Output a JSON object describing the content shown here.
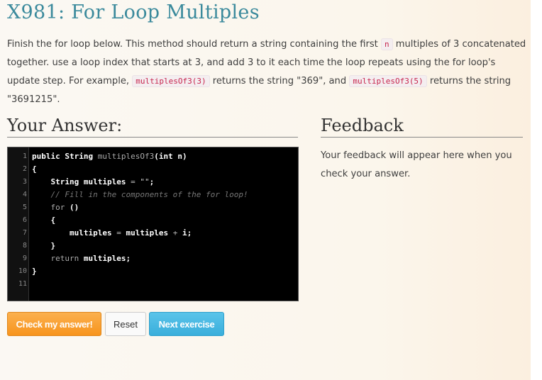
{
  "title": "X981: For Loop Multiples",
  "description": {
    "p1": "Finish the for loop below. This method should return a string containing the first ",
    "code_n": "n",
    "p2": " multiples of 3 concatenated together. use a loop index that starts at 3, and add 3 to it each time the loop repeats using the for loop's update step. For example, ",
    "code_ex1": "multiplesOf3(3)",
    "p3": " returns the string \"369\", and ",
    "code_ex2": "multiplesOf3(5)",
    "p4": " returns the string \"3691215\"."
  },
  "answer": {
    "heading": "Your Answer:"
  },
  "feedback": {
    "heading": "Feedback",
    "text": "Your feedback will appear here when you check your answer."
  },
  "editor": {
    "lines": [
      {
        "num": "1",
        "tokens": [
          [
            "kw",
            "public "
          ],
          [
            "type",
            "String "
          ],
          [
            "fn",
            "multiplesOf3"
          ],
          [
            "kw",
            "(int n)"
          ]
        ]
      },
      {
        "num": "2",
        "tokens": [
          [
            "kw",
            "{"
          ]
        ]
      },
      {
        "num": "3",
        "tokens": [
          [
            "kw",
            "    String multiples "
          ],
          [
            "op",
            "= "
          ],
          [
            "str",
            "\"\""
          ],
          [
            "kw",
            ";"
          ]
        ]
      },
      {
        "num": "4",
        "tokens": [
          [
            "cmt",
            "    // Fill in the components of the for loop!"
          ]
        ]
      },
      {
        "num": "5",
        "tokens": [
          [
            "fn",
            "    for "
          ],
          [
            "kw",
            "()"
          ]
        ]
      },
      {
        "num": "6",
        "tokens": [
          [
            "kw",
            "    {"
          ]
        ]
      },
      {
        "num": "7",
        "tokens": [
          [
            "kw",
            "        multiples "
          ],
          [
            "op",
            "= "
          ],
          [
            "kw",
            "multiples "
          ],
          [
            "op",
            "+ "
          ],
          [
            "kw",
            "i;"
          ]
        ]
      },
      {
        "num": "8",
        "tokens": [
          [
            "kw",
            "    }"
          ]
        ]
      },
      {
        "num": "9",
        "tokens": [
          [
            "fn",
            "    return "
          ],
          [
            "kw",
            "multiples;"
          ]
        ]
      },
      {
        "num": "10",
        "tokens": [
          [
            "kw",
            "}"
          ]
        ]
      },
      {
        "num": "11",
        "tokens": []
      }
    ]
  },
  "buttons": {
    "check": "Check my answer!",
    "reset": "Reset",
    "next": "Next exercise"
  }
}
